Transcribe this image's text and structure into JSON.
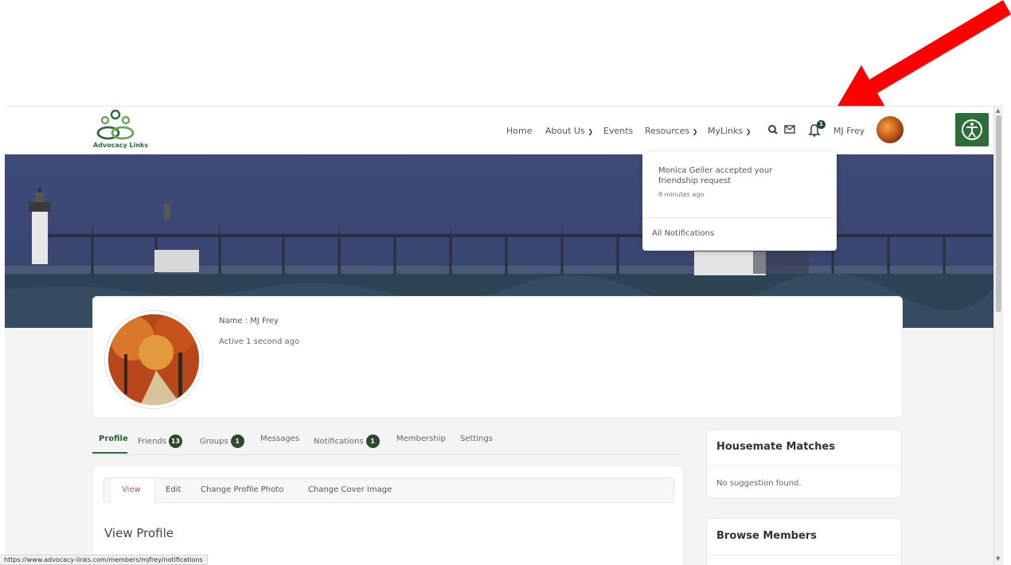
{
  "colors": {
    "brand_green": "#2c6e3a",
    "badge_dark": "#2b4a2e",
    "arrow_red": "#ff0000",
    "active_subtab": "#c0504d"
  },
  "header": {
    "logo_text": "Advocacy Links",
    "nav": [
      "Home",
      "About Us",
      "Events",
      "Resources",
      "MyLinks"
    ],
    "dropdown_nav": [
      "About Us",
      "Resources",
      "MyLinks"
    ],
    "icons": [
      "search-icon",
      "mail-icon",
      "bell-icon"
    ],
    "bell_count": "1",
    "user_name": "MJ Frey",
    "accessibility_icon": "accessibility-icon"
  },
  "notifications_dropdown": {
    "message": "Monica Geller accepted your friendship request",
    "time": "9 minutes ago",
    "all_link": "All Notifications"
  },
  "profile": {
    "name_label": "Name : MJ Frey",
    "active": "Active 1 second ago"
  },
  "tabs": [
    {
      "label": "Profile",
      "badge": ""
    },
    {
      "label": "Friends",
      "badge": "13"
    },
    {
      "label": "Groups",
      "badge": "1"
    },
    {
      "label": "Messages",
      "badge": ""
    },
    {
      "label": "Notifications",
      "badge": "1"
    },
    {
      "label": "Membership",
      "badge": ""
    },
    {
      "label": "Settings",
      "badge": ""
    }
  ],
  "subtabs": [
    "View",
    "Edit",
    "Change Profile Photo",
    "Change Cover Image"
  ],
  "main": {
    "title": "View Profile"
  },
  "sidebar": {
    "housemate": {
      "title": "Housemate Matches",
      "body": "No suggestion found."
    },
    "browse": {
      "title": "Browse Members"
    }
  },
  "status_url": "https://www.advocacy-links.com/members/mjfrey/notifications"
}
